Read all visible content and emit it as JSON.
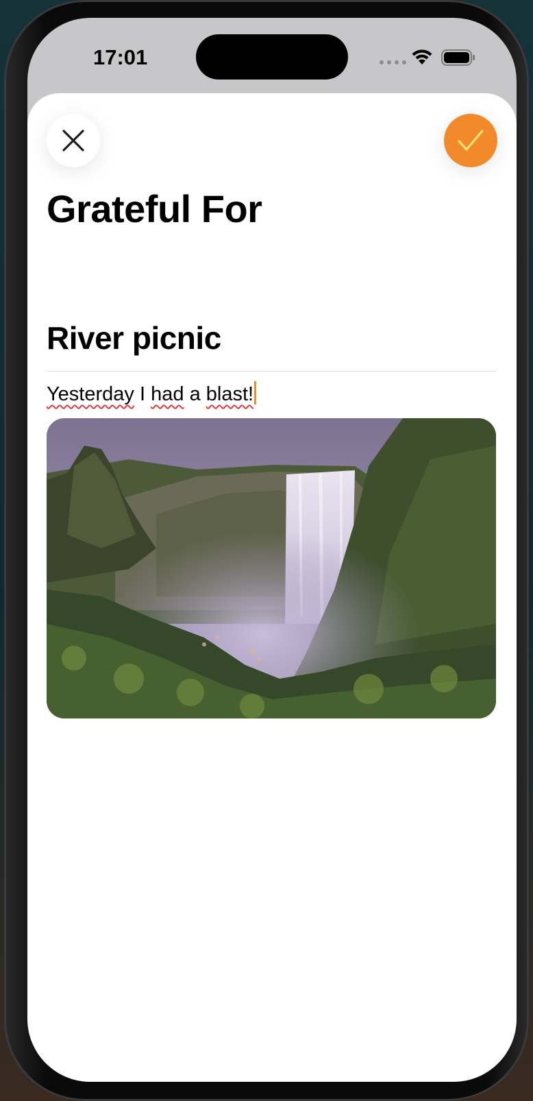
{
  "status_bar": {
    "time": "17:01"
  },
  "header": {
    "close_icon": "close-icon",
    "confirm_icon": "checkmark-icon",
    "accent_color": "#f28a2c"
  },
  "page": {
    "title": "Grateful For"
  },
  "entry": {
    "title": "River picnic",
    "body_words": [
      "Yesterday",
      "I",
      "had",
      "a",
      "blast!"
    ],
    "photo_description_icon": "waterfall-photo"
  }
}
